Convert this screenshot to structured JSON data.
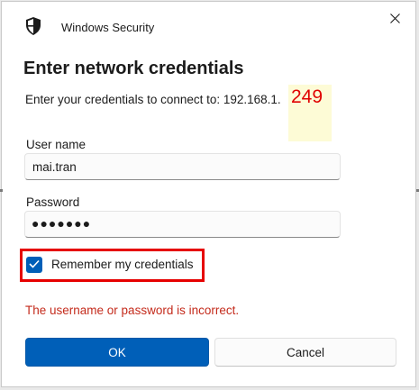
{
  "window": {
    "app_title": "Windows Security",
    "close_icon": "close-icon",
    "app_icon": "shield-icon"
  },
  "main": {
    "heading": "Enter network credentials",
    "prompt": "Enter your credentials to connect to: 192.168.1.",
    "ip_last_octet": "249"
  },
  "form": {
    "username_label": "User name",
    "username_value": "mai.tran",
    "password_label": "Password",
    "password_display": "●●●●●●●",
    "remember_label": "Remember my credentials",
    "remember_checked": true,
    "error_message": "The username or password is incorrect."
  },
  "buttons": {
    "ok_label": "OK",
    "cancel_label": "Cancel"
  },
  "colors": {
    "accent": "#005fb8",
    "error": "#c42b1c",
    "highlight_box": "#e60000",
    "ip_emphasis": "#e00000"
  }
}
